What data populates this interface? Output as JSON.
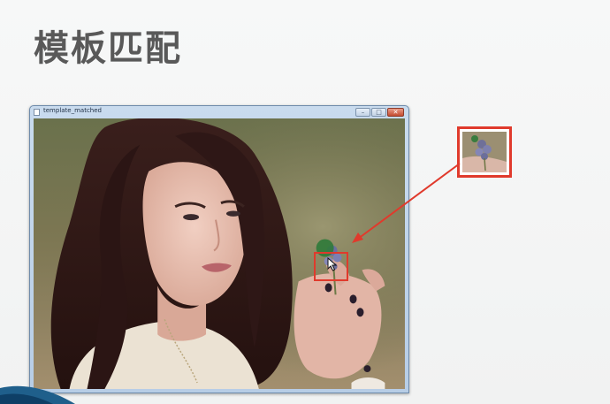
{
  "slide": {
    "title": "模板匹配"
  },
  "window": {
    "title": "template_matched",
    "controls": {
      "minimize": "–",
      "maximize": "□",
      "close": "✕"
    }
  },
  "icons": {
    "window_icon": "window-icon",
    "cursor": "move-cursor-icon",
    "arrow": "arrow-icon"
  },
  "colors": {
    "highlight": "#e03a2c",
    "title_text": "#595959",
    "window_frame": "#b7cde6"
  }
}
